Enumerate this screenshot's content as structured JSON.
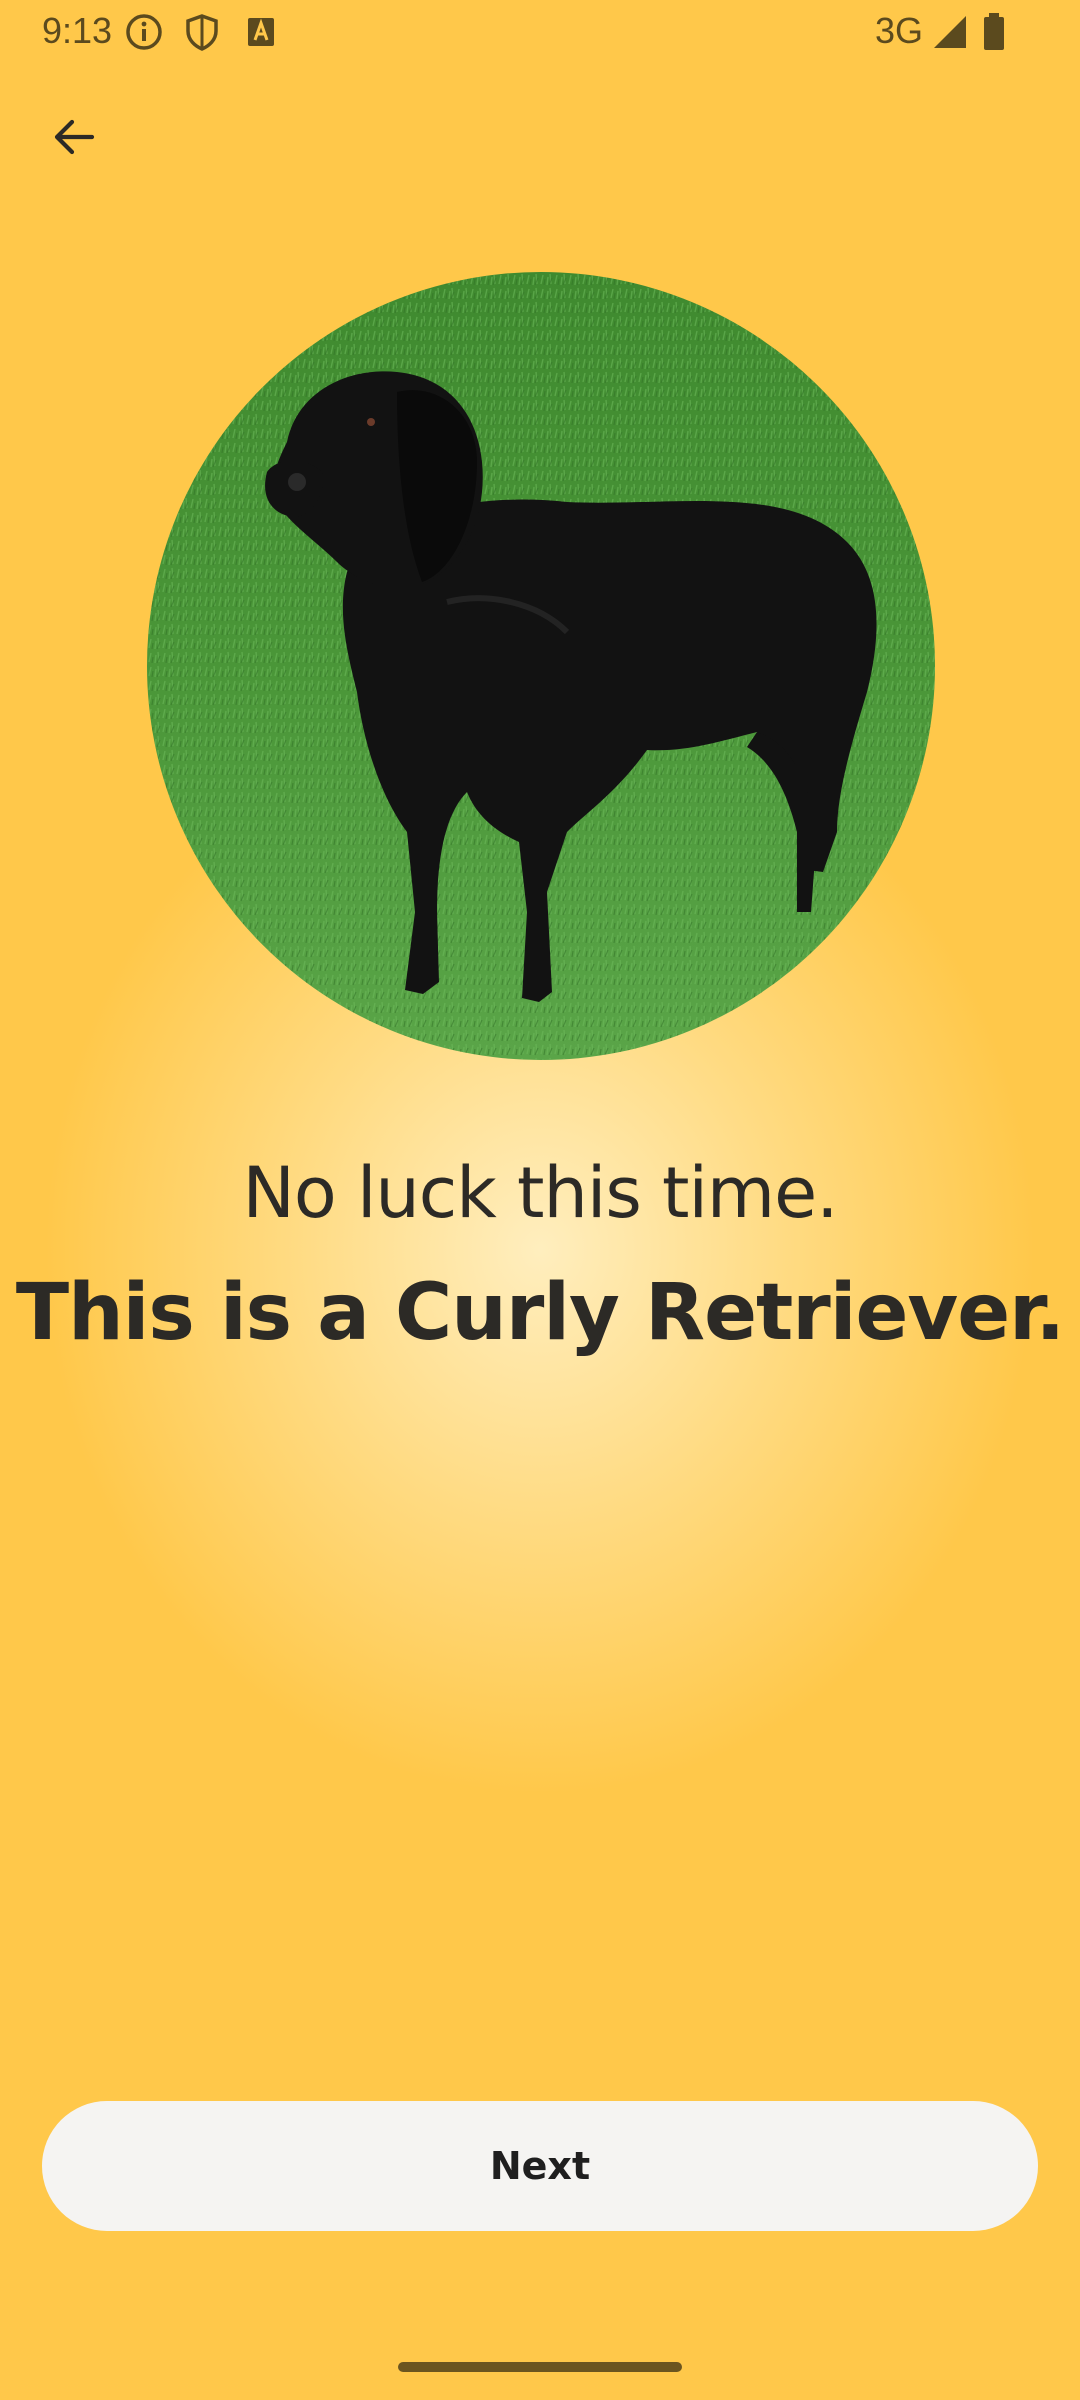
{
  "status_bar": {
    "time": "9:13",
    "network": "3G",
    "icons": [
      "info-icon",
      "shield-icon",
      "text-icon",
      "signal-icon",
      "battery-icon"
    ]
  },
  "navigation": {
    "back_icon": "arrow-left-icon"
  },
  "result": {
    "message": "No luck this time.",
    "answer": "This is a Curly Retriever."
  },
  "actions": {
    "next_label": "Next"
  },
  "colors": {
    "background": "#FFC84A",
    "button": "#f5f4f2",
    "text": "#2c2a26"
  }
}
